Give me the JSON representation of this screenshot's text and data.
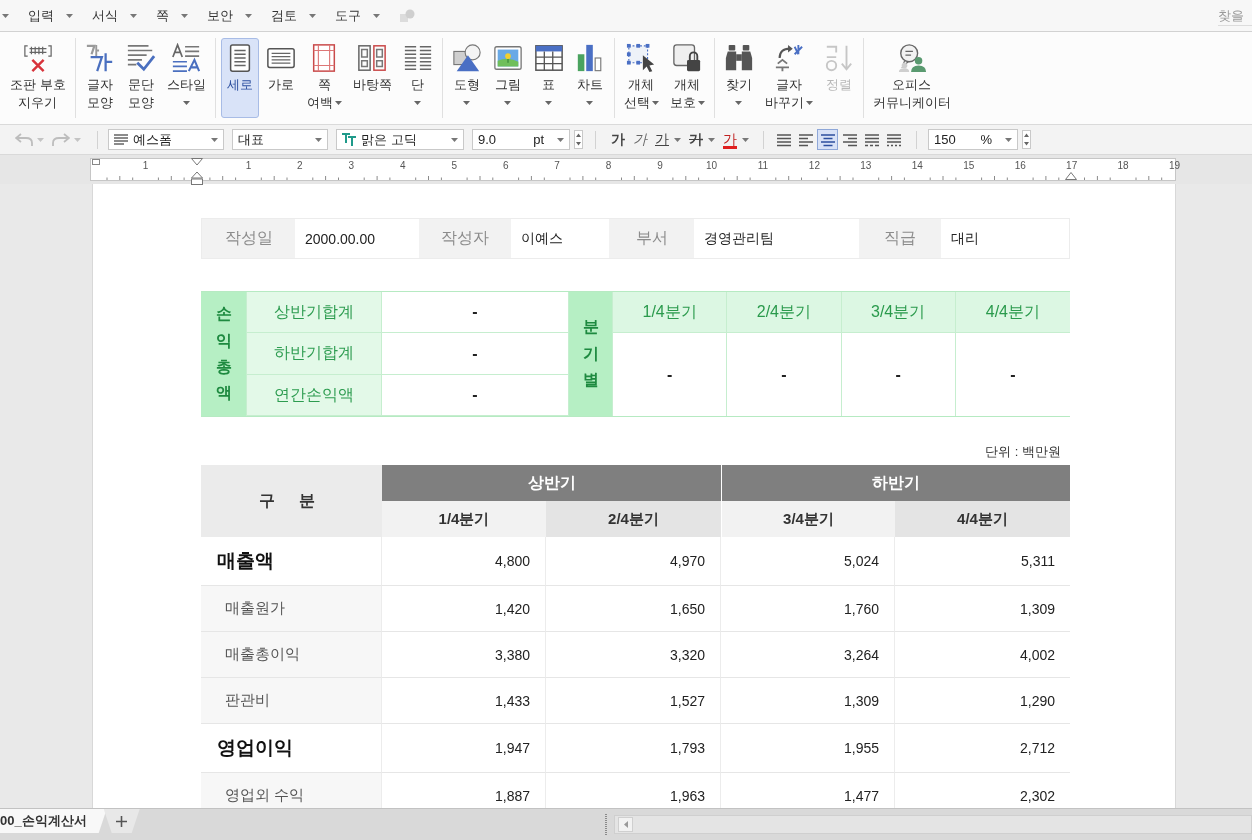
{
  "menubar": {
    "menus": [
      {
        "label": "입력"
      },
      {
        "label": "서식"
      },
      {
        "label": "쪽"
      },
      {
        "label": "보안"
      },
      {
        "label": "검토"
      },
      {
        "label": "도구"
      }
    ],
    "search": {
      "placeholder": "찾을"
    }
  },
  "ribbon": {
    "groups": [
      {
        "buttons": [
          {
            "lines": [
              "조판 부호",
              "지우기"
            ],
            "dropdown": false,
            "selected": false,
            "disabled": false
          }
        ]
      },
      {
        "buttons": [
          {
            "lines": [
              "글자",
              "모양"
            ],
            "dropdown": false,
            "selected": false,
            "disabled": false
          },
          {
            "lines": [
              "문단",
              "모양"
            ],
            "dropdown": false,
            "selected": false,
            "disabled": false
          },
          {
            "lines": [
              "스타일"
            ],
            "dropdown": true,
            "selected": false,
            "disabled": false
          }
        ]
      },
      {
        "buttons": [
          {
            "lines": [
              "세로"
            ],
            "dropdown": false,
            "selected": true,
            "disabled": false
          },
          {
            "lines": [
              "가로"
            ],
            "dropdown": false,
            "selected": false,
            "disabled": false
          },
          {
            "lines": [
              "쪽",
              "여백"
            ],
            "dropdown": true,
            "selected": false,
            "disabled": false
          },
          {
            "lines": [
              "바탕쪽"
            ],
            "dropdown": false,
            "selected": false,
            "disabled": false
          },
          {
            "lines": [
              "단"
            ],
            "dropdown": true,
            "selected": false,
            "disabled": false
          }
        ]
      },
      {
        "buttons": [
          {
            "lines": [
              "도형"
            ],
            "dropdown": true,
            "selected": false,
            "disabled": false
          },
          {
            "lines": [
              "그림"
            ],
            "dropdown": true,
            "selected": false,
            "disabled": false
          },
          {
            "lines": [
              "표"
            ],
            "dropdown": true,
            "selected": false,
            "disabled": false
          },
          {
            "lines": [
              "차트"
            ],
            "dropdown": true,
            "selected": false,
            "disabled": false
          }
        ]
      },
      {
        "buttons": [
          {
            "lines": [
              "개체",
              "선택"
            ],
            "dropdown": true,
            "selected": false,
            "disabled": false
          },
          {
            "lines": [
              "개체",
              "보호"
            ],
            "dropdown": true,
            "selected": false,
            "disabled": false
          }
        ]
      },
      {
        "buttons": [
          {
            "lines": [
              "찾기"
            ],
            "dropdown": true,
            "selected": false,
            "disabled": false
          },
          {
            "lines": [
              "글자",
              "바꾸기"
            ],
            "dropdown": true,
            "selected": false,
            "disabled": false
          },
          {
            "lines": [
              "정렬"
            ],
            "dropdown": false,
            "selected": false,
            "disabled": true
          }
        ]
      },
      {
        "buttons": [
          {
            "lines": [
              "오피스",
              "커뮤니케이터"
            ],
            "dropdown": false,
            "selected": false,
            "disabled": false
          }
        ]
      }
    ]
  },
  "toolbar": {
    "history": [
      {
        "disabled": true
      },
      {
        "disabled": true
      }
    ],
    "style": "예스폼",
    "paragraph_style": "대표",
    "font": "맑은 고딕",
    "size": {
      "value": "9.0",
      "unit": "pt"
    },
    "char_buttons": [
      {
        "label": "가",
        "kind": "bold",
        "dropdown": false
      },
      {
        "label": "가",
        "kind": "italic",
        "dropdown": false
      },
      {
        "label": "가",
        "kind": "underline",
        "dropdown": true
      },
      {
        "label": "가",
        "kind": "strike",
        "dropdown": true
      },
      {
        "label": "가",
        "kind": "color",
        "dropdown": true
      }
    ],
    "align_buttons": [
      {
        "selected": false
      },
      {
        "selected": false
      },
      {
        "selected": true
      },
      {
        "selected": false
      },
      {
        "selected": false
      },
      {
        "selected": false
      }
    ],
    "zoom": {
      "value": "150",
      "unit": "%"
    }
  },
  "ruler": {
    "labels": [
      "1",
      "1",
      "2",
      "3",
      "4",
      "5",
      "6",
      "7",
      "8",
      "9",
      "10",
      "11",
      "12",
      "13",
      "14",
      "15",
      "16",
      "17",
      "18",
      "19"
    ]
  },
  "document": {
    "info": [
      {
        "label": "작성일",
        "value": "2000.00.00"
      },
      {
        "label": "작성자",
        "value": "이예스"
      },
      {
        "label": "부서",
        "value": "경영관리팀"
      },
      {
        "label": "직급",
        "value": "대리"
      }
    ],
    "summary": {
      "title": "손익총액",
      "rows": [
        {
          "label": "상반기합계",
          "value": "-"
        },
        {
          "label": "하반기합계",
          "value": "-"
        },
        {
          "label": "연간손익액",
          "value": "-"
        }
      ],
      "quarter_title": "분기별",
      "quarters": [
        {
          "label": "1/4분기",
          "value": "-"
        },
        {
          "label": "2/4분기",
          "value": "-"
        },
        {
          "label": "3/4분기",
          "value": "-"
        },
        {
          "label": "4/4분기",
          "value": "-"
        }
      ]
    },
    "unit": "단위 : 백만원",
    "statement": {
      "corner": "구 분",
      "halves": [
        "상반기",
        "하반기"
      ],
      "quarters": [
        "1/4분기",
        "2/4분기",
        "3/4분기",
        "4/4분기"
      ],
      "rows": [
        {
          "label": "매출액",
          "kind": "heading",
          "values": [
            "4,800",
            "4,970",
            "5,024",
            "5,311"
          ]
        },
        {
          "label": "매출원가",
          "kind": "item",
          "values": [
            "1,420",
            "1,650",
            "1,760",
            "1,309"
          ]
        },
        {
          "label": "매출총이익",
          "kind": "item",
          "values": [
            "3,380",
            "3,320",
            "3,264",
            "4,002"
          ]
        },
        {
          "label": "판관비",
          "kind": "item",
          "values": [
            "1,433",
            "1,527",
            "1,309",
            "1,290"
          ]
        },
        {
          "label": "영업이익",
          "kind": "heading",
          "values": [
            "1,947",
            "1,793",
            "1,955",
            "2,712"
          ]
        },
        {
          "label": "영업외 수익",
          "kind": "item",
          "values": [
            "1,887",
            "1,963",
            "1,477",
            "2,302"
          ]
        }
      ]
    }
  },
  "sheet_tabs": [
    {
      "label": "00_손익계산서",
      "selected": true
    }
  ]
}
